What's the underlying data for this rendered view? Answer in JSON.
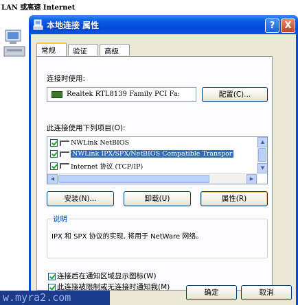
{
  "background": {
    "title": "LAN 或高速 Internet"
  },
  "window": {
    "title": "本地连接 属性",
    "help_label": "?",
    "close_label": "X"
  },
  "tabs": [
    {
      "label": "常规"
    },
    {
      "label": "验证"
    },
    {
      "label": "高级"
    }
  ],
  "general": {
    "connect_using_label": "连接时使用:",
    "adapter_name": "Realtek RTL8139 Family PCI Fa:",
    "configure_button": "配置(C)...",
    "components_label": "此连接使用下列项目(O):",
    "components": [
      {
        "label": "NWLink NetBIOS",
        "checked": true,
        "selected": false
      },
      {
        "label": "NWLink IPX/SPX/NetBIOS Compatible Transpor",
        "checked": true,
        "selected": true
      },
      {
        "label": "Internet 协议 (TCP/IP)",
        "checked": true,
        "selected": false
      }
    ],
    "install_button": "安装(N)...",
    "uninstall_button": "卸载(U)",
    "properties_button": "属性(R)",
    "description_title": "说明",
    "description_text": "IPX 和 SPX 协议的实现, 将用于 NetWare 网络。",
    "show_icon_checkbox": "连接后在通知区域显示图标(W)",
    "notify_checkbox": "此连接被限制或无连接时通知我(M)"
  },
  "footer": {
    "ok_button": "确定",
    "cancel_button": "取消"
  },
  "watermark": {
    "text": "w.myra2.com"
  },
  "colors": {
    "titlebar": "#0a5de8",
    "client_bg": "#ece9d8",
    "selection": "#316ac5",
    "group_title": "#0046d5"
  }
}
